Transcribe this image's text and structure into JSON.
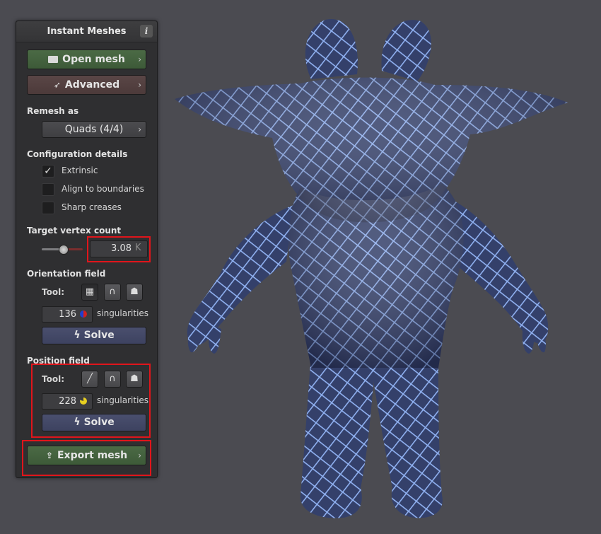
{
  "panel": {
    "title": "Instant Meshes",
    "info_icon": "i",
    "open_mesh_label": "Open mesh",
    "advanced_label": "Advanced",
    "remesh_as_label": "Remesh as",
    "remesh_value": "Quads (4/4)",
    "config_label": "Configuration details",
    "options": [
      {
        "label": "Extrinsic",
        "checked": true
      },
      {
        "label": "Align to boundaries",
        "checked": false
      },
      {
        "label": "Sharp creases",
        "checked": false
      }
    ],
    "target_label": "Target vertex count",
    "target_value": "3.08",
    "target_unit": "K",
    "orientation_label": "Orientation field",
    "orientation_tool_label": "Tool:",
    "orientation_singularities": "136",
    "orientation_singularities_label": "singularities",
    "orientation_solve_label": "Solve",
    "position_label": "Position field",
    "position_tool_label": "Tool:",
    "position_singularities": "228",
    "position_singularities_label": "singularities",
    "position_solve_label": "Solve",
    "export_label": "Export mesh"
  },
  "icons": {
    "folder": "folder-icon",
    "rocket": "rocket-icon",
    "comb": "comb-icon",
    "magnet": "magnet-icon",
    "ghost": "ghost-icon",
    "brush": "brush-icon",
    "bolt": "bolt-icon",
    "export": "export-icon"
  },
  "colors": {
    "highlight": "#e0151b",
    "mesh_body": "#3a466e",
    "mesh_lines": "#8fb0f0",
    "background": "#4b4b51"
  }
}
